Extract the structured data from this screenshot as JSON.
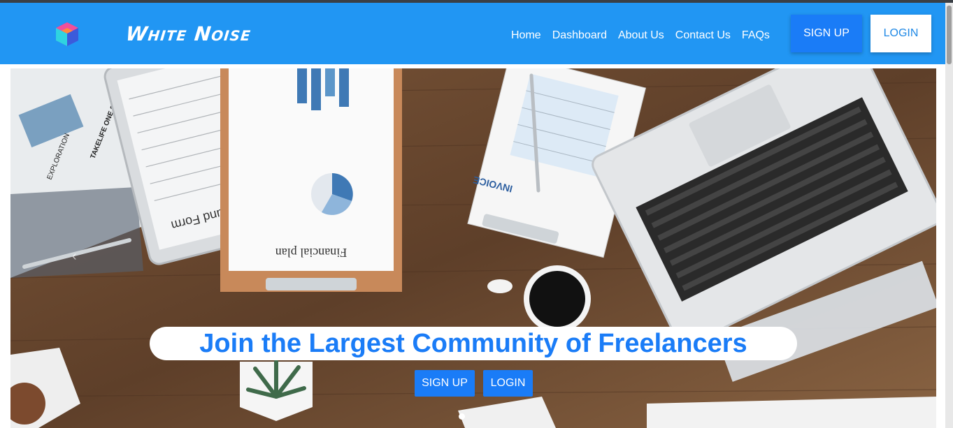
{
  "brand": {
    "name": "White Noise"
  },
  "nav": {
    "links": [
      "Home",
      "Dashboard",
      "About Us",
      "Contact Us",
      "FAQs"
    ],
    "signup_label": "SIGN UP",
    "login_label": "LOGIN"
  },
  "hero": {
    "title": "Join the Largest Community of Freelancers",
    "signup_label": "SIGN UP",
    "login_label": "LOGIN"
  },
  "photo_text": {
    "tax_form": "Tax Refund Form",
    "financial_plan": "Financial plan",
    "invoice": "INVOICE",
    "newspaper_1": "EXPLORATION",
    "newspaper_2": "TAKELIFE ONE SIP AT A TIME"
  },
  "colors": {
    "navbar": "#2196f3",
    "accent": "#1a7cf7",
    "white": "#ffffff"
  }
}
